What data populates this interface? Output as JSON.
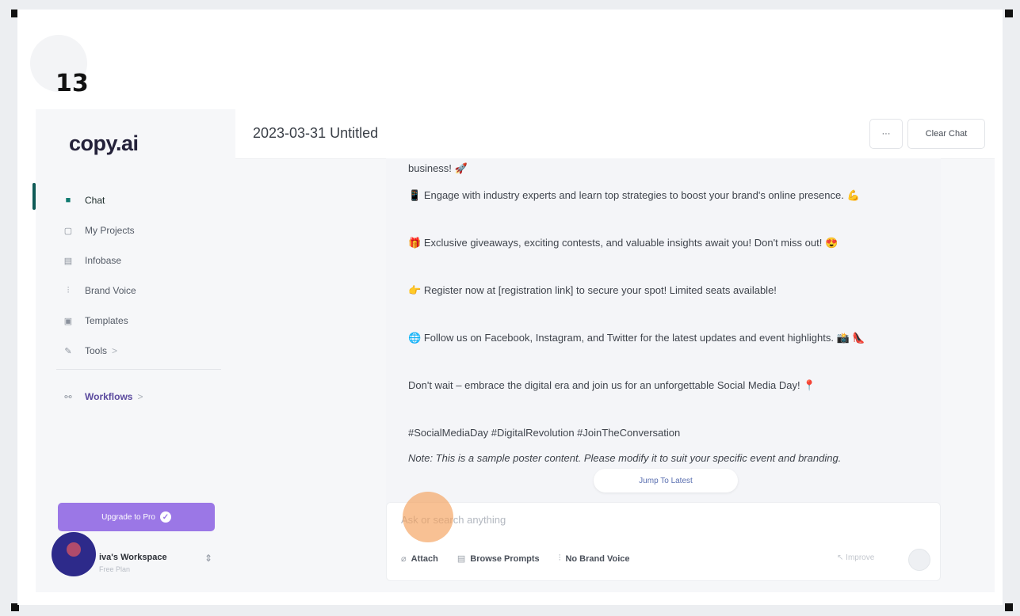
{
  "step_number": "13",
  "sidebar": {
    "logo": "copy.ai",
    "items": [
      {
        "label": "Chat",
        "icon": "chat-icon",
        "glyph": "■"
      },
      {
        "label": "My Projects",
        "icon": "projects-icon",
        "glyph": "▢"
      },
      {
        "label": "Infobase",
        "icon": "database-icon",
        "glyph": "▤"
      },
      {
        "label": "Brand Voice",
        "icon": "brand-voice-icon",
        "glyph": "⫶"
      },
      {
        "label": "Templates",
        "icon": "templates-icon",
        "glyph": "▣"
      },
      {
        "label": "Tools",
        "icon": "wrench-icon",
        "glyph": "✎"
      }
    ],
    "tools_chevron": ">",
    "workflows_label": "Workflows",
    "workflows_chevron": ">",
    "upgrade_label": "Upgrade to Pro",
    "upgrade_check": "✓",
    "workspace_name": "iva's Workspace",
    "workspace_plan": "Free Plan",
    "workspace_switch": "⇕"
  },
  "header": {
    "title": "2023-03-31 Untitled",
    "more_label": "···",
    "clear_label": "Clear Chat"
  },
  "messages": [
    {
      "text": "business!",
      "emoji": "🚀"
    },
    {
      "emoji_lead": "📱",
      "text": "Engage with industry experts and learn top strategies to boost your brand's online presence.",
      "emoji": "💪"
    },
    {
      "emoji_lead": "🎁",
      "text": "Exclusive giveaways, exciting contests, and valuable insights await you! Don't miss out!",
      "emoji": "😍"
    },
    {
      "emoji_lead": "👉",
      "text": "Register now at [registration link] to secure your spot! Limited seats available!"
    },
    {
      "emoji_lead": "🌐",
      "text": "Follow us on Facebook, Instagram, and Twitter for the latest updates and event highlights.",
      "emoji": "📸 👠"
    },
    {
      "text": "Don't wait – embrace the digital era and join us for an unforgettable Social Media Day!",
      "emoji": "📍"
    },
    {
      "text": "#SocialMediaDay #DigitalRevolution #JoinTheConversation"
    },
    {
      "text": "Note: This is a sample poster content. Please modify it to suit your specific event and branding."
    }
  ],
  "jump_label": "Jump To Latest",
  "composer": {
    "placeholder": "Ask or search anything",
    "attach_label": "Attach",
    "browse_label": "Browse Prompts",
    "brand_voice_label": "No Brand Voice",
    "improve_label": "Improve",
    "attach_glyph": "⌀",
    "browse_glyph": "▤",
    "brand_glyph": "⫶",
    "improve_glyph": "↖"
  }
}
